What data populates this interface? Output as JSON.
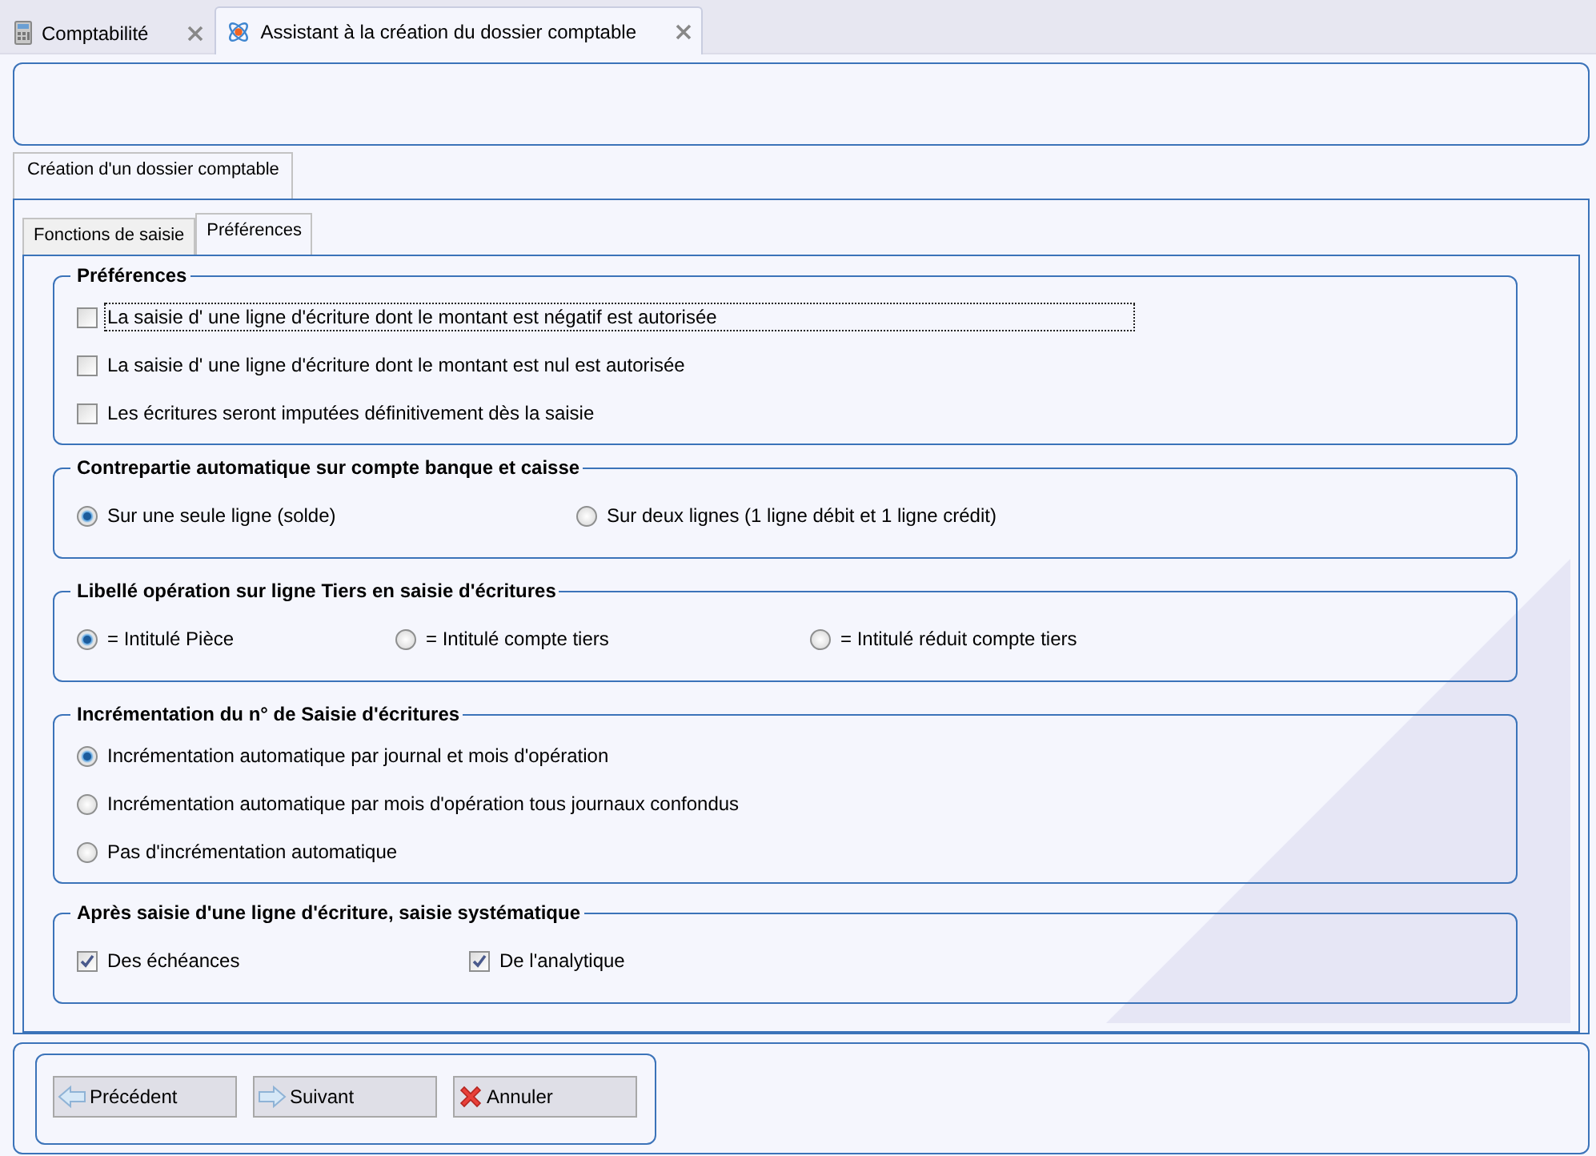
{
  "doc_tabs": [
    {
      "label": "Comptabilité",
      "selected": false
    },
    {
      "label": "Assistant à la création du dossier comptable",
      "selected": true
    }
  ],
  "wizard_tabs": [
    {
      "label": "Création d'un dossier comptable",
      "selected": true
    }
  ],
  "page_tabs": [
    {
      "label": "Fonctions de saisie",
      "selected": false
    },
    {
      "label": "Préférences",
      "selected": true
    }
  ],
  "groups": [
    {
      "title": "Préférences",
      "kind": "checkbox",
      "options": [
        {
          "label": "La saisie d' une ligne d'écriture dont le montant est négatif est autorisée",
          "checked": false,
          "focused": true
        },
        {
          "label": "La saisie d' une ligne d'écriture dont le montant est nul est autorisée",
          "checked": false,
          "focused": false
        },
        {
          "label": "Les écritures seront imputées définitivement dès la saisie",
          "checked": false,
          "focused": false
        }
      ]
    },
    {
      "title": "Contrepartie automatique sur compte banque et caisse",
      "kind": "radio",
      "options": [
        {
          "label": "Sur une seule ligne (solde)",
          "selected": true
        },
        {
          "label": "Sur deux lignes (1 ligne débit et 1 ligne crédit)",
          "selected": false
        }
      ]
    },
    {
      "title": "Libellé opération sur ligne Tiers en saisie d'écritures",
      "kind": "radio",
      "options": [
        {
          "label": "= Intitulé Pièce",
          "selected": true
        },
        {
          "label": "= Intitulé compte tiers",
          "selected": false
        },
        {
          "label": "= Intitulé réduit compte tiers",
          "selected": false
        }
      ]
    },
    {
      "title": "Incrémentation du n° de Saisie d'écritures",
      "kind": "radio",
      "options": [
        {
          "label": "Incrémentation automatique par journal et mois d'opération",
          "selected": true
        },
        {
          "label": "Incrémentation automatique par mois d'opération tous journaux confondus",
          "selected": false
        },
        {
          "label": "Pas d'incrémentation automatique",
          "selected": false
        }
      ]
    },
    {
      "title": "Après saisie d'une ligne d'écriture, saisie systématique",
      "kind": "checkbox",
      "options": [
        {
          "label": "Des échéances",
          "checked": true
        },
        {
          "label": "De l'analytique",
          "checked": true
        }
      ]
    }
  ],
  "buttons": [
    {
      "label": "Précédent",
      "kind": "back"
    },
    {
      "label": "Suivant",
      "kind": "next"
    },
    {
      "label": "Annuler",
      "kind": "cancel"
    }
  ]
}
